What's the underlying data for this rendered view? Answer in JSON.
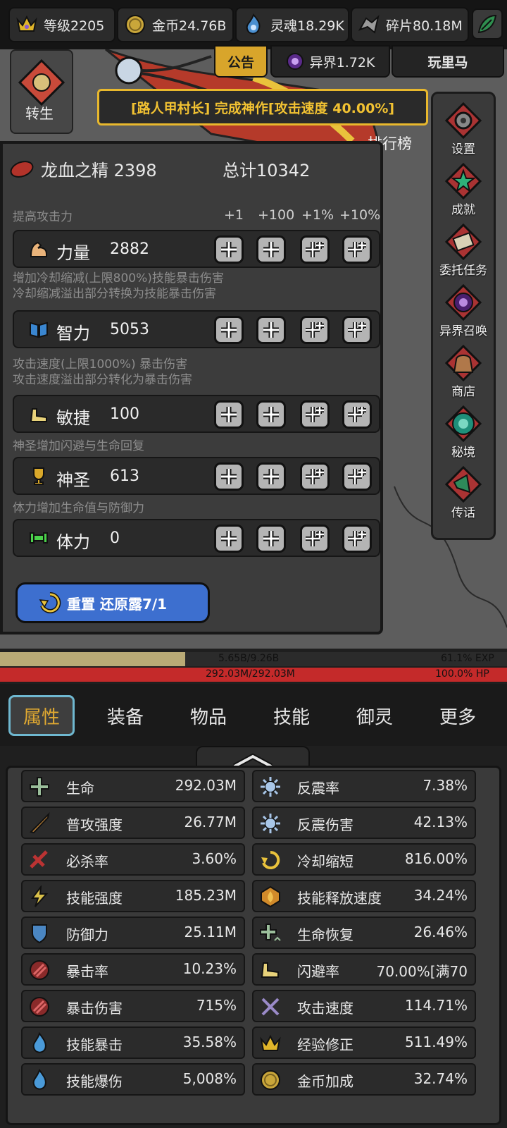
{
  "topbar": {
    "level": "等级2205",
    "gold": "金币24.76B",
    "soul": "灵魂18.29K",
    "shards": "碎片80.18M"
  },
  "scene": {
    "notice_tab": "公告",
    "realm_tab": "异界1.72K",
    "player_tab": "玩里马",
    "banner": "[路人甲村长] 完成神作[攻击速度 40.00%]",
    "rebirth": "转生",
    "rank": "排行榜"
  },
  "rightrail": {
    "items": [
      "设置",
      "成就",
      "委托任务",
      "异界召唤",
      "商店",
      "秘境",
      "传话"
    ]
  },
  "panel": {
    "essence_label": "龙血之精 2398",
    "total_label": "总计10342",
    "increments": [
      "+1",
      "+100",
      "+1%",
      "+10%"
    ],
    "hints": {
      "str": "提高攻击力",
      "int_1": "增加冷却缩减(上限800%)技能暴击伤害",
      "int_2": "冷却缩减溢出部分转换为技能暴击伤害",
      "agi_1": "攻击速度(上限1000%) 暴击伤害",
      "agi_2": "攻击速度溢出部分转化为暴击伤害",
      "holy": "神圣增加闪避与生命回复",
      "vit": "体力增加生命值与防御力"
    },
    "stats": [
      {
        "name": "力量",
        "value": "2882"
      },
      {
        "name": "智力",
        "value": "5053"
      },
      {
        "name": "敏捷",
        "value": "100"
      },
      {
        "name": "神圣",
        "value": "613"
      },
      {
        "name": "体力",
        "value": "0"
      }
    ],
    "reset_label": "重置 还原露7/1"
  },
  "bars": {
    "exp_text": "5.65B/9.26B",
    "exp_pct": "61.1% EXP",
    "exp_fraction": 0.611,
    "hp_text": "292.03M/292.03M",
    "hp_pct": "100.0%  HP"
  },
  "tabs": [
    "属性",
    "装备",
    "物品",
    "技能",
    "御灵",
    "更多"
  ],
  "stats_grid": {
    "left": [
      {
        "name": "生命",
        "value": "292.03M"
      },
      {
        "name": "普攻强度",
        "value": "26.77M"
      },
      {
        "name": "必杀率",
        "value": "3.60%"
      },
      {
        "name": "技能强度",
        "value": "185.23M"
      },
      {
        "name": "防御力",
        "value": "25.11M"
      },
      {
        "name": "暴击率",
        "value": "10.23%"
      },
      {
        "name": "暴击伤害",
        "value": "715%"
      },
      {
        "name": "技能暴击",
        "value": "35.58%"
      },
      {
        "name": "技能爆伤",
        "value": "5,008%"
      }
    ],
    "right": [
      {
        "name": "反震率",
        "value": "7.38%"
      },
      {
        "name": "反震伤害",
        "value": "42.13%"
      },
      {
        "name": "冷却缩短",
        "value": "816.00%"
      },
      {
        "name": "技能释放速度",
        "value": "34.24%"
      },
      {
        "name": "生命恢复",
        "value": "26.46%"
      },
      {
        "name": "闪避率",
        "value": "70.00%[满70"
      },
      {
        "name": "攻击速度",
        "value": "114.71%"
      },
      {
        "name": "经验修正",
        "value": "511.49%"
      },
      {
        "name": "金币加成",
        "value": "32.74%"
      }
    ]
  },
  "colors": {
    "accent_gold": "#e8b82d",
    "exp_fill": "#b9aa76",
    "hp_fill": "#c42a2a",
    "reset_blue": "#3d6fcf"
  }
}
